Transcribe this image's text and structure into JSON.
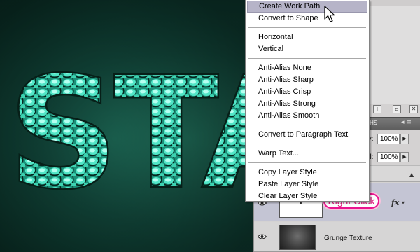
{
  "context_menu": {
    "groups": [
      [
        {
          "label": "Create Work Path",
          "highlighted": true
        },
        {
          "label": "Convert to Shape"
        }
      ],
      [
        {
          "label": "Horizontal"
        },
        {
          "label": "Vertical"
        }
      ],
      [
        {
          "label": "Anti-Alias None"
        },
        {
          "label": "Anti-Alias Sharp"
        },
        {
          "label": "Anti-Alias Crisp"
        },
        {
          "label": "Anti-Alias Strong"
        },
        {
          "label": "Anti-Alias Smooth"
        }
      ],
      [
        {
          "label": "Convert to Paragraph Text"
        }
      ],
      [
        {
          "label": "Warp Text..."
        }
      ],
      [
        {
          "label": "Copy Layer Style"
        },
        {
          "label": "Paste Layer Style"
        },
        {
          "label": "Clear Layer Style"
        }
      ]
    ]
  },
  "layers_panel": {
    "tab_stub": "HS",
    "opacity": {
      "label": "ty:",
      "value": "100%"
    },
    "fill": {
      "label": "ill:",
      "value": "100%"
    },
    "layers": [
      {
        "thumb_text": "T",
        "fx": "fx"
      },
      {
        "name": "Grunge Texture"
      }
    ]
  },
  "canvas": {
    "artwork_text": "STA"
  },
  "callout": {
    "text": "Right Click"
  },
  "colors": {
    "menu_highlight": "#b6b4c8",
    "callout_border": "#ea148f",
    "callout_text": "#e4147e",
    "text_layer_row": "#c4c5d4",
    "canvas_bg": "#134c3f",
    "artwork_teal": "#2fc7a6"
  },
  "icons": [
    "eye-icon",
    "fx-icon",
    "arrow-cursor-icon",
    "text-layer-thumbnail-icon"
  ]
}
